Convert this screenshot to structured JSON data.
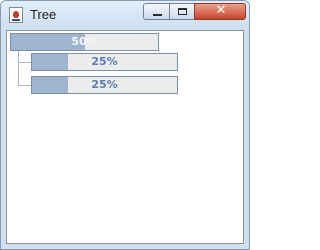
{
  "window": {
    "title": "Tree",
    "close_glyph": "✕"
  },
  "tree": {
    "root": {
      "label": "50%",
      "progress": 0.5
    },
    "children": [
      {
        "label": "25%",
        "progress": 0.25
      },
      {
        "label": "25%",
        "progress": 0.25
      }
    ]
  },
  "icons": [
    "java-app-icon",
    "minimize-icon",
    "maximize-icon",
    "close-icon"
  ],
  "colors": {
    "bar_fill": "#9fb5cf",
    "bar_track": "#ececec",
    "bar_border": "#7d8fa8",
    "label_text": "#5a7cb6",
    "close_button": "#c7432b"
  }
}
